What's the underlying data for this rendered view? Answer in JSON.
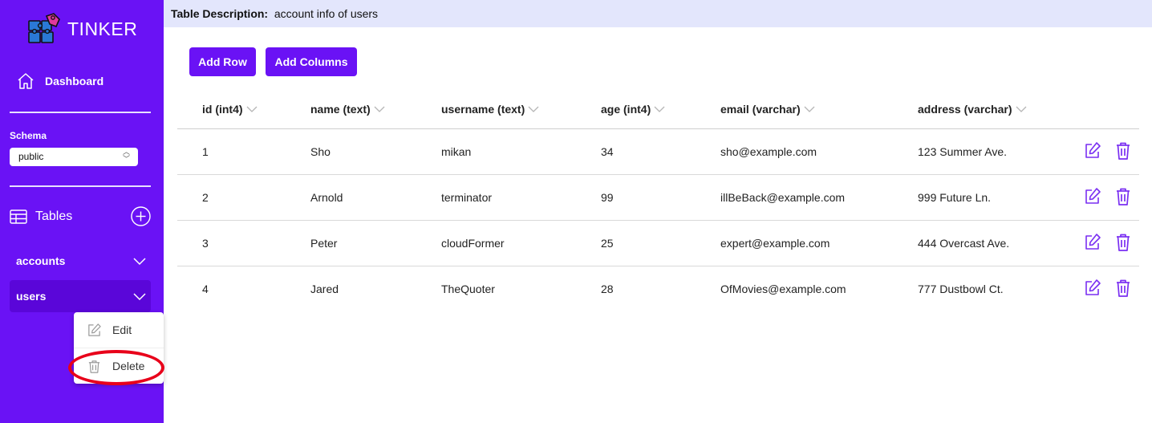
{
  "app": {
    "name": "TINKER"
  },
  "sidebar": {
    "dashboard_label": "Dashboard",
    "schema_label": "Schema",
    "schema_value": "public",
    "tables_label": "Tables",
    "tables": [
      {
        "label": "accounts",
        "active": false
      },
      {
        "label": "users",
        "active": true
      }
    ]
  },
  "context_menu": {
    "edit_label": "Edit",
    "delete_label": "Delete"
  },
  "table_description": {
    "label": "Table Description:",
    "value": "account info of users"
  },
  "toolbar": {
    "add_row_label": "Add Row",
    "add_columns_label": "Add Columns"
  },
  "table": {
    "columns": [
      "id (int4)",
      "name (text)",
      "username (text)",
      "age (int4)",
      "email (varchar)",
      "address (varchar)"
    ],
    "rows": [
      [
        "1",
        "Sho",
        "mikan",
        "34",
        "sho@example.com",
        "123 Summer Ave."
      ],
      [
        "2",
        "Arnold",
        "terminator",
        "99",
        "illBeBack@example.com",
        "999 Future Ln."
      ],
      [
        "3",
        "Peter",
        "cloudFormer",
        "25",
        "expert@example.com",
        "444 Overcast Ave."
      ],
      [
        "4",
        "Jared",
        "TheQuoter",
        "28",
        "OfMovies@example.com",
        "777 Dustbowl Ct."
      ]
    ]
  },
  "colors": {
    "accent": "#6a12f5",
    "sidebar_active": "#5a06d9",
    "action_icon": "#7a2ff2",
    "description_bar": "#e3e6fc",
    "highlight_ring": "#e8001a"
  },
  "icons": {
    "logo": "puzzle-logo-icon",
    "dashboard": "home-icon",
    "tables": "table-grid-icon",
    "add_table": "plus-circle-icon",
    "expand": "chevron-down-icon",
    "sort": "chevron-down-icon",
    "edit": "pencil-square-icon",
    "delete": "trash-icon"
  }
}
